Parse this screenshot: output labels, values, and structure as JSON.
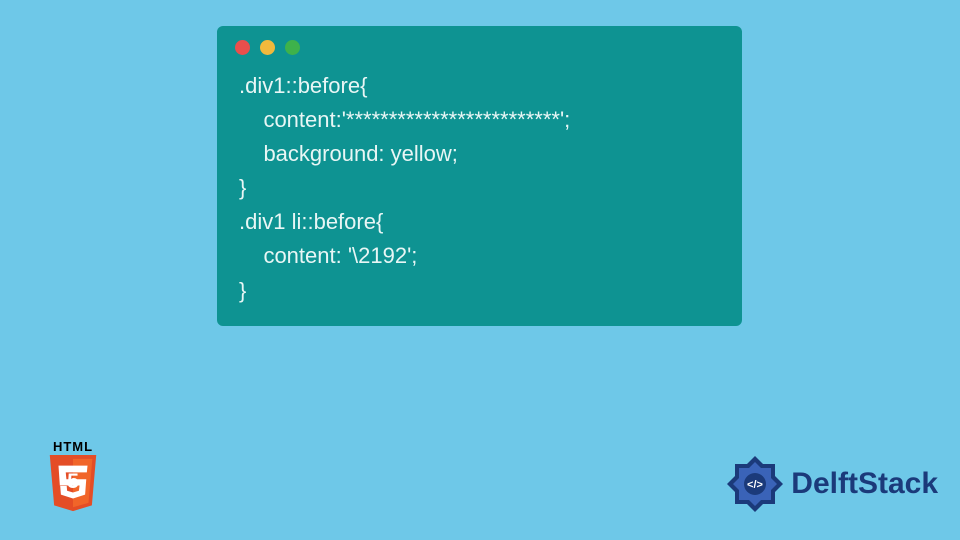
{
  "code": {
    "line1": ".div1::before{",
    "line2": "    content:'*************************';",
    "line3": "    background: yellow;",
    "line4": "}",
    "line5": ".div1 li::before{",
    "line6": "    content: '\\2192';",
    "line7": "}"
  },
  "badges": {
    "html5_label": "HTML",
    "html5_number": "5",
    "delftstack_label": "DelftStack"
  },
  "colors": {
    "background": "#6ec8e8",
    "window": "#0e9392",
    "code_text": "#e8f6f5",
    "html5_orange": "#e44d26",
    "html5_light": "#f16529",
    "ds_blue": "#1b3a7a"
  }
}
